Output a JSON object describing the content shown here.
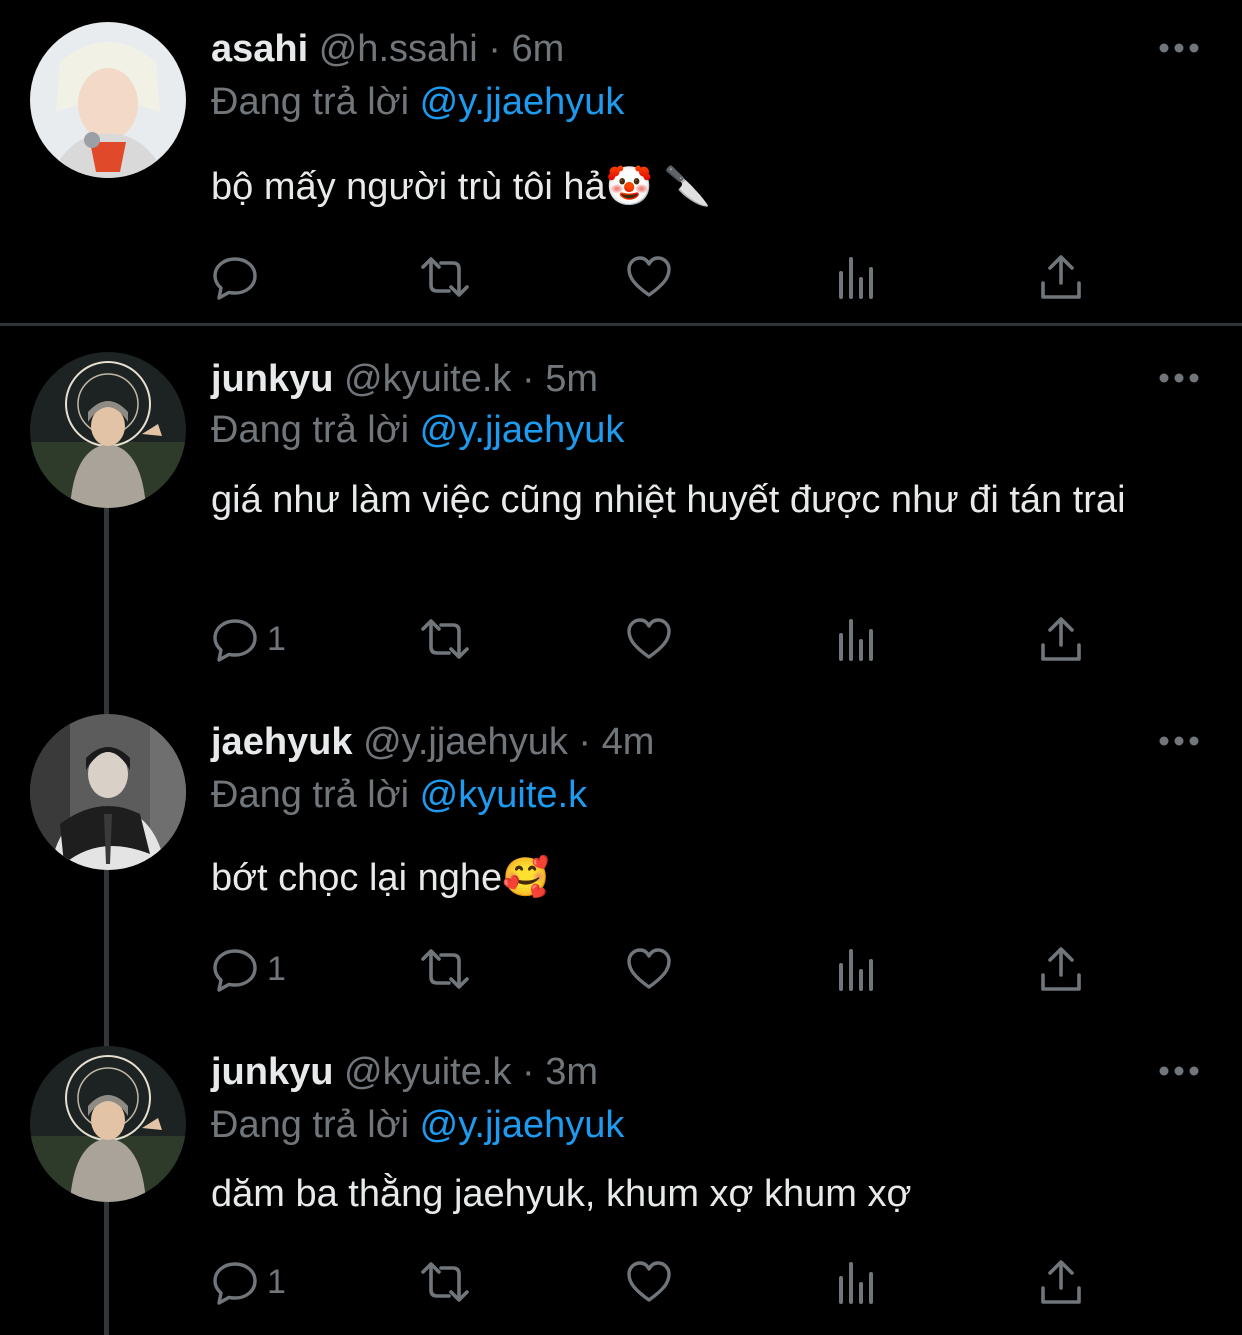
{
  "tweets": [
    {
      "name": "asahi",
      "handle": "@h.ssahi",
      "separator": "·",
      "time": "6m",
      "reply_prefix": "Đang trả lời",
      "reply_to": "@y.jjaehyuk",
      "text": "bộ mấy người trù tôi hả🤡 🔪",
      "reply_count": ""
    },
    {
      "name": "junkyu",
      "handle": "@kyuite.k",
      "separator": "·",
      "time": "5m",
      "reply_prefix": "Đang trả lời",
      "reply_to": "@y.jjaehyuk",
      "text": "giá như làm việc cũng nhiệt huyết được như đi tán trai",
      "reply_count": "1"
    },
    {
      "name": "jaehyuk",
      "handle": "@y.jjaehyuk",
      "separator": "·",
      "time": "4m",
      "reply_prefix": "Đang trả lời",
      "reply_to": "@kyuite.k",
      "text": "bớt chọc lại nghe🥰",
      "reply_count": "1"
    },
    {
      "name": "junkyu",
      "handle": "@kyuite.k",
      "separator": "·",
      "time": "3m",
      "reply_prefix": "Đang trả lời",
      "reply_to": "@y.jjaehyuk",
      "text": "dăm ba thằng jaehyuk, khum xợ khum xợ",
      "reply_count": "1"
    }
  ],
  "icons": [
    "more-icon",
    "reply-icon",
    "retweet-icon",
    "like-icon",
    "views-icon",
    "share-icon"
  ],
  "colors": {
    "background": "#000000",
    "text": "#e7e9ea",
    "muted": "#71767b",
    "accent": "#1d9bf0",
    "divider": "#2f3336"
  }
}
